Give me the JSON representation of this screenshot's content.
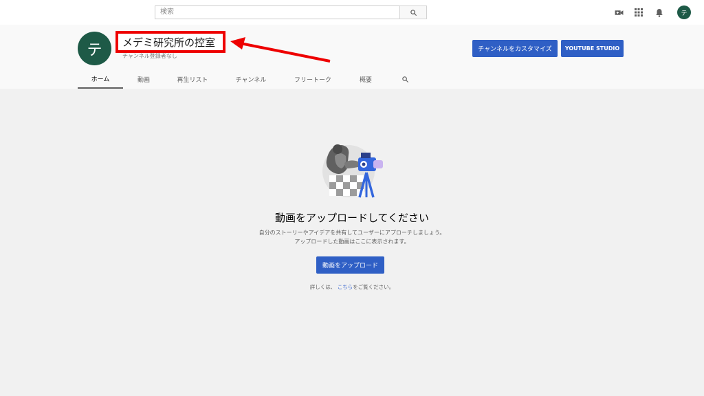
{
  "topbar": {
    "search_placeholder": "検索",
    "avatar_letter": "テ",
    "icons": [
      "video-camera-icon",
      "apps-grid-icon",
      "bell-icon",
      "search-icon"
    ]
  },
  "channel": {
    "avatar_letter": "テ",
    "title": "メデミ研究所の控室",
    "subscribers": "チャンネル登録者なし",
    "customize_label": "チャンネルをカスタマイズ",
    "studio_label": "YOUTUBE STUDIO",
    "tabs": [
      {
        "label": "ホーム",
        "active": true
      },
      {
        "label": "動画",
        "active": false
      },
      {
        "label": "再生リスト",
        "active": false
      },
      {
        "label": "チャンネル",
        "active": false
      },
      {
        "label": "フリートーク",
        "active": false
      },
      {
        "label": "概要",
        "active": false
      }
    ]
  },
  "empty_state": {
    "title": "動画をアップロードしてください",
    "desc_line1": "自分のストーリーやアイデアを共有してユーザーにアプローチしましょう。",
    "desc_line2": "アップロードした動画はここに表示されます。",
    "upload_label": "動画をアップロード",
    "detail_prefix": "詳しくは、",
    "detail_link": "こちら",
    "detail_suffix": "をご覧ください。"
  },
  "colors": {
    "accent_blue": "#2f5fc5",
    "annotation_red": "#ee0000",
    "avatar_green": "#1e5a47"
  }
}
